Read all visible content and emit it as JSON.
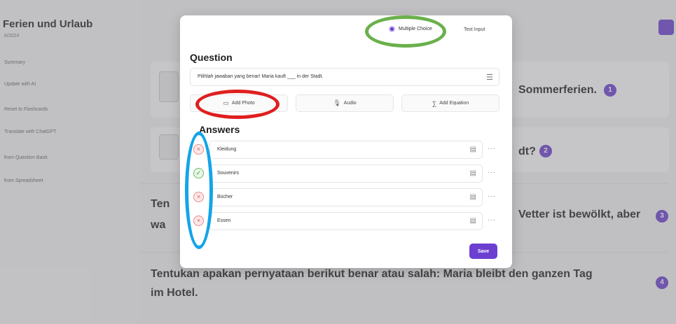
{
  "background": {
    "title": "Ferien und Urlaub",
    "subtitle": "6/2024",
    "nav_items": [
      "Summary",
      "Update with AI",
      "Reset to Flashcards",
      "Translate with ChatGPT",
      "from Question Bank",
      "from Spreadsheet"
    ],
    "questions": [
      {
        "number": "1",
        "text": "Sommerferien."
      },
      {
        "number": "2",
        "text": "dt?"
      },
      {
        "number": "3",
        "text_left": "Ten",
        "text_right": "Vetter ist bewölkt, aber",
        "text_left2": "wa"
      },
      {
        "number": "4",
        "text": "Tentukan apakan pernyataan berikut benar atau salah: Maria bleibt den ganzen Tag",
        "text2": "im Hotel."
      }
    ]
  },
  "modal": {
    "type_toggle": {
      "multiple_choice": "Multiple Choice",
      "text_input": "Text Input"
    },
    "question_heading": "Question",
    "question_value": "Pilihlah jawaban yang benar!  Maria kauft ___ in der Stadt.",
    "media_buttons": {
      "photo": "Add Photo",
      "audio": "Audio",
      "equation": "Add Equation"
    },
    "answers_heading": "Answers",
    "answers": [
      {
        "text": "Kleidung",
        "correct": false
      },
      {
        "text": "Souvenirs",
        "correct": true
      },
      {
        "text": "Bücher",
        "correct": false
      },
      {
        "text": "Essen",
        "correct": false
      }
    ],
    "save_label": "Save"
  },
  "colors": {
    "accent": "#6c3fd1",
    "annotation_green": "#6ab04c",
    "annotation_red": "#e01e1e",
    "annotation_blue": "#12a5e8"
  }
}
